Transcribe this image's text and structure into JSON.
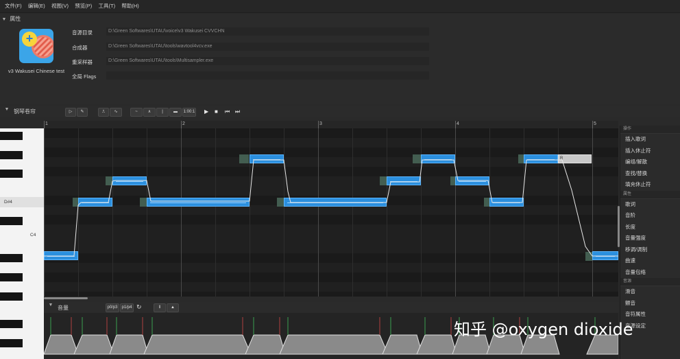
{
  "menu": [
    "文件(F)",
    "编辑(E)",
    "视图(V)",
    "预览(P)",
    "工具(T)",
    "帮助(H)"
  ],
  "properties": {
    "header": "属性",
    "singer_name": "v3 Wakusei Chinese test",
    "rows": [
      {
        "label": "音源目录",
        "value": "D:\\Green Softwares\\UTAU\\voice\\v3 Wakusei CVVCHN"
      },
      {
        "label": "合成器",
        "value": "D:\\Green Softwares\\UTAU\\tools\\wavtool4vcv.exe"
      },
      {
        "label": "重采样器",
        "value": "D:\\Green Softwares\\UTAU\\tools\\Multisampler.exe"
      },
      {
        "label": "全局 Flags",
        "value": ""
      }
    ]
  },
  "piano_roll": {
    "header": "钢琴卷帘",
    "bpm_button": "1:00:1",
    "ruler": [
      "1",
      "2",
      "3",
      "4",
      "5"
    ],
    "key_labels": [
      "D#4",
      "C4"
    ],
    "rest_label": "R",
    "colors": {
      "note": "#2b8fde",
      "note_border": "#5cb6ff",
      "rest": "#c8c8c8"
    }
  },
  "expression": {
    "header": "音量",
    "btn_a": "p0/p3",
    "btn_b": "p1/p4"
  },
  "side_panel": {
    "sections": [
      {
        "header": "操作",
        "items": [
          "插入歌词",
          "插入休止符",
          "编组/解散",
          "查找/替换",
          "填充休止符"
        ]
      },
      {
        "header": "属性",
        "items": [
          "歌词",
          "音阶",
          "长度",
          "音量强度",
          "移调/调制",
          "曲速",
          "音量包络"
        ]
      },
      {
        "header": "音源",
        "items": [
          "滑音",
          "颤音",
          "音符属性",
          "音源设定"
        ]
      }
    ]
  },
  "watermark": "知乎 @oxygen dioxide"
}
